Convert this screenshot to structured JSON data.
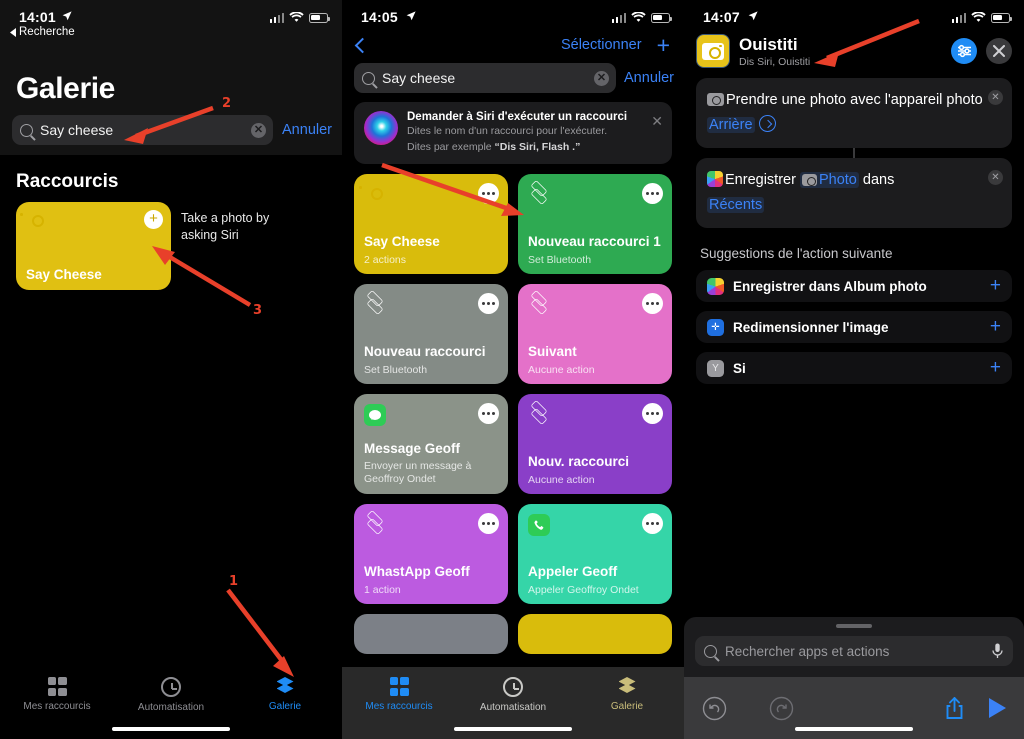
{
  "panel1": {
    "status": {
      "time": "14:01",
      "back_label": "Recherche"
    },
    "title": "Galerie",
    "search": {
      "value": "Say cheese",
      "cancel": "Annuler"
    },
    "section_title": "Raccourcis",
    "card": {
      "name": "Say Cheese",
      "color": "#E0C012"
    },
    "note": "Take a photo by asking Siri",
    "tabs": [
      {
        "label": "Mes raccourcis",
        "icon": "grid-icon",
        "active": false
      },
      {
        "label": "Automatisation",
        "icon": "clock-icon",
        "active": false
      },
      {
        "label": "Galerie",
        "icon": "layers-icon",
        "active": true
      }
    ]
  },
  "panel2": {
    "status": {
      "time": "14:05"
    },
    "nav": {
      "select": "Sélectionner",
      "add": "+"
    },
    "search": {
      "value": "Say cheese",
      "cancel": "Annuler"
    },
    "siri_banner": {
      "title": "Demander à Siri d'exécuter un raccourci",
      "line1": "Dites le nom d'un raccourci pour l'exécuter.",
      "line2_prefix": "Dites par exemple ",
      "line2_bold": "“Dis Siri, Flash .”"
    },
    "cards": [
      {
        "title": "Say Cheese",
        "subtitle": "2 actions",
        "color": "#D9BC0C",
        "icon": "camera-icon"
      },
      {
        "title": "Nouveau raccourci 1",
        "subtitle": "Set Bluetooth",
        "color": "#2EAA52",
        "icon": "layers-icon"
      },
      {
        "title": "Nouveau raccourci",
        "subtitle": "Set Bluetooth",
        "color": "#848B86",
        "icon": "layers-icon"
      },
      {
        "title": "Suivant",
        "subtitle": "Aucune action",
        "color": "#E471C9",
        "icon": "layers-icon"
      },
      {
        "title": "Message Geoff",
        "subtitle": "Envoyer un message à Geoffroy Ondet",
        "color": "#8B9389",
        "icon": "messages-icon"
      },
      {
        "title": "Nouv. raccourci",
        "subtitle": "Aucune action",
        "color": "#8A3FC8",
        "icon": "layers-icon"
      },
      {
        "title": "WhastApp Geoff",
        "subtitle": "1 action",
        "color": "#BC5BE0",
        "icon": "layers-icon"
      },
      {
        "title": "Appeler Geoff",
        "subtitle": "Appeler Geoffroy Ondet",
        "color": "#35D5A8",
        "icon": "phone-icon"
      }
    ],
    "partial_cards": [
      {
        "color": "#7C8087"
      },
      {
        "color": "#D9BC0C"
      }
    ],
    "tabs": [
      {
        "label": "Mes raccourcis",
        "icon": "grid-icon",
        "active": true
      },
      {
        "label": "Automatisation",
        "icon": "clock-icon",
        "active": false
      },
      {
        "label": "Galerie",
        "icon": "layers-icon",
        "active": false
      }
    ]
  },
  "panel3": {
    "status": {
      "time": "14:07"
    },
    "header": {
      "name": "Ouistiti",
      "subtitle": "Dis Siri, Ouistiti",
      "icon_color": "#E7C31A"
    },
    "actions": [
      {
        "seg1": "Prendre une photo avec l'appareil photo ",
        "token": "Arrière",
        "icon": "camera-icon",
        "has_chevron": true
      },
      {
        "seg1": "Enregistrer ",
        "token": "Photo",
        "seg2": " dans ",
        "token2": "Récents",
        "icon": "photos-icon",
        "has_chevron": false
      }
    ],
    "suggestions_title": "Suggestions de l'action suivante",
    "suggestions": [
      {
        "label": "Enregistrer dans Album photo",
        "icon": "photos-icon",
        "add": "+"
      },
      {
        "label": "Redimensionner l'image",
        "icon": "resize-icon",
        "add": "+"
      },
      {
        "label": "Si",
        "icon": "if-icon",
        "add": "+"
      }
    ],
    "sheet": {
      "search_placeholder": "Rechercher apps et actions"
    },
    "toolbar": {
      "undo": "undo-icon",
      "redo": "redo-icon",
      "share": "share-icon",
      "play": "play-icon"
    }
  },
  "annotations": [
    {
      "number": "1",
      "target": "galerie-tab"
    },
    {
      "number": "2",
      "target": "search-field"
    },
    {
      "number": "3",
      "target": "add-shortcut-plus"
    }
  ],
  "colors": {
    "accent_blue": "#3b82f6",
    "annotation_red": "#E8402A"
  }
}
